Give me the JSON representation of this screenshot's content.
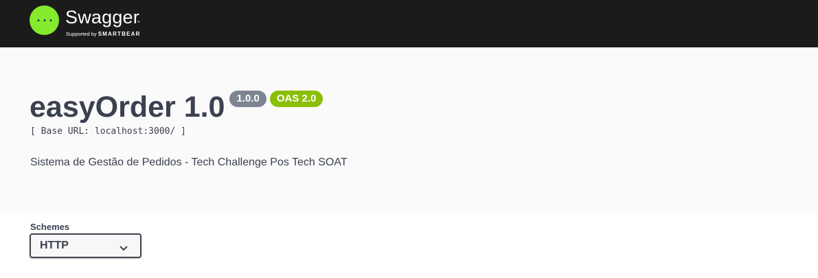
{
  "topbar": {
    "logo_name": "Swagger",
    "logo_tm": "™",
    "supported_prefix": "Supported by ",
    "supported_brand": "SMARTBEAR",
    "logo_icon": "swagger-braces-icon",
    "background": "#1b1b1b",
    "accent": "#85ea2d"
  },
  "info": {
    "title": "easyOrder 1.0",
    "version_badge": "1.0.0",
    "oas_badge": "OAS 2.0",
    "base_url": "[ Base URL: localhost:3000/ ]",
    "description": "Sistema de Gestão de Pedidos - Tech Challenge Pos Tech SOAT",
    "version_badge_color": "#7d8492",
    "oas_badge_color": "#89bf04"
  },
  "schemes": {
    "label": "Schemes",
    "selected": "HTTP",
    "dropdown_icon": "chevron-down-icon"
  }
}
